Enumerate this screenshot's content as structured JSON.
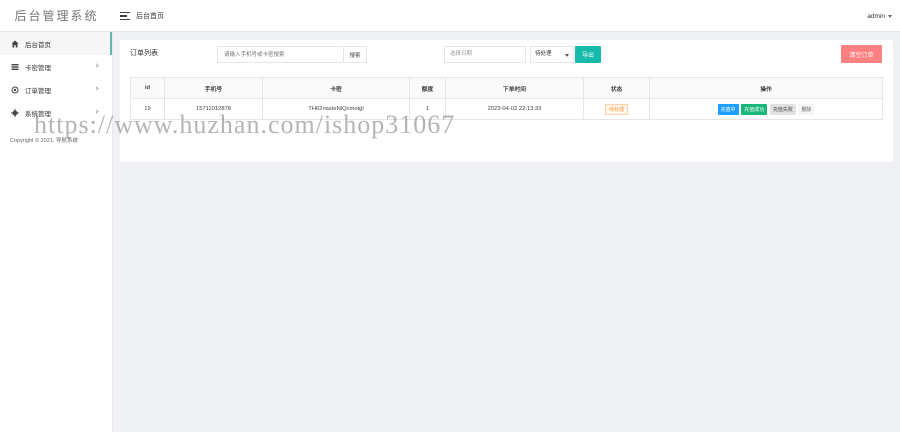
{
  "app": {
    "title": "后台管理系统"
  },
  "header": {
    "breadcrumb": "后台首页",
    "user": "admin"
  },
  "sidebar": {
    "items": [
      {
        "label": "后台首页",
        "icon": "home-icon",
        "active": true
      },
      {
        "label": "卡密管理",
        "icon": "list-icon",
        "active": false
      },
      {
        "label": "订单管理",
        "icon": "layers-icon",
        "active": false
      },
      {
        "label": "系统管理",
        "icon": "gear-icon",
        "active": false
      }
    ],
    "copyright": "Copyright © 2021, 导航系统"
  },
  "toolbar": {
    "title": "订单列表",
    "search_placeholder": "请输入手机号或卡密搜索",
    "search_label": "搜索",
    "date_placeholder": "选择日期",
    "status_selected": "待处理",
    "export_label": "导出",
    "clear_label": "清空订单"
  },
  "table": {
    "headers": [
      "id",
      "手机号",
      "卡密",
      "额度",
      "下单时间",
      "状态",
      "操作"
    ],
    "rows": [
      {
        "id": "19",
        "phone": "15711012878",
        "card": "TH62nasIeNiQcmotgl",
        "amount": "1",
        "time": "2023-04-02 22:13:33",
        "status": "待处理",
        "actions": [
          "充值中",
          "充值成功",
          "充值失败",
          "删除"
        ]
      }
    ]
  },
  "watermark": "https://www.huzhan.com/ishop31067"
}
